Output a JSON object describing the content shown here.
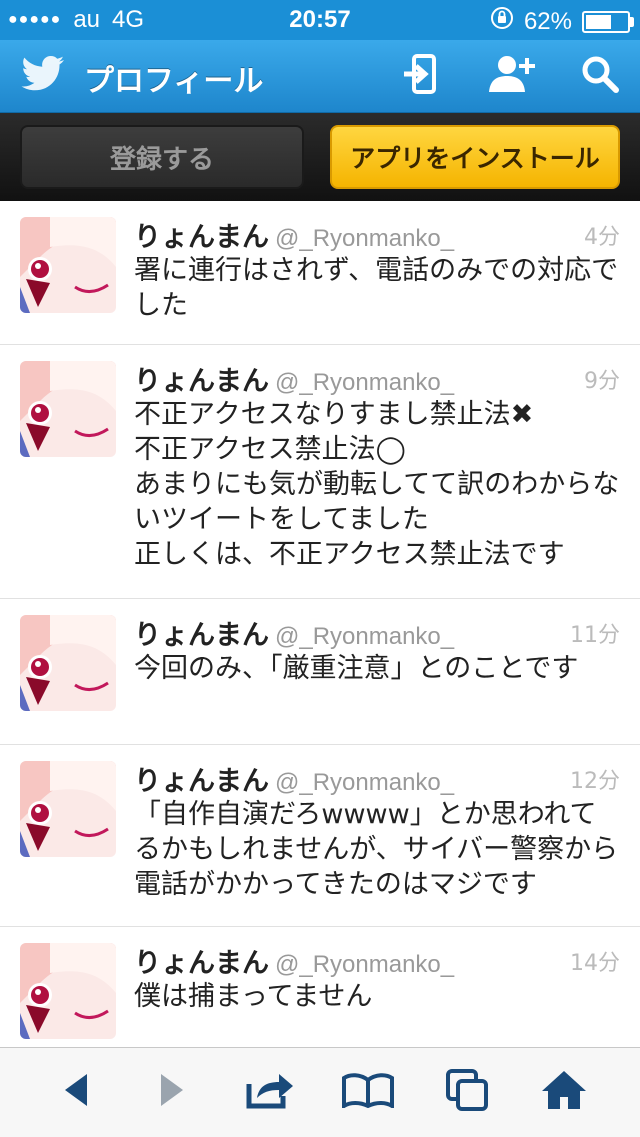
{
  "status_bar": {
    "carrier": "au",
    "network": "4G",
    "time": "20:57",
    "battery_percent": "62%",
    "battery_level": 0.62
  },
  "nav": {
    "title": "プロフィール"
  },
  "actions": {
    "register_label": "登録する",
    "install_label": "アプリをインストール"
  },
  "colors": {
    "status_bar_bg": "#1b8fd6",
    "nav_bg": "#2a98de",
    "install_button": "#fcc31c",
    "action_bar_bg": "#1c1c1c"
  },
  "tweets": [
    {
      "name": "りょんまん",
      "handle": "@_Ryonmanko_",
      "time": "4分",
      "text": "署に連行はされず、電話のみでの対応でした"
    },
    {
      "name": "りょんまん",
      "handle": "@_Ryonmanko_",
      "time": "9分",
      "text": "不正アクセスなりすまし禁止法✖\n不正アクセス禁止法◯\nあまりにも気が動転してて訳のわからないツイートをしてました\n正しくは、不正アクセス禁止法です"
    },
    {
      "name": "りょんまん",
      "handle": "@_Ryonmanko_",
      "time": "11分",
      "text": "今回のみ、「厳重注意」とのことです"
    },
    {
      "name": "りょんまん",
      "handle": "@_Ryonmanko_",
      "time": "12分",
      "text": "「自作自演だろwwww」とか思われてるかもしれませんが、サイバー警察から電話がかかってきたのはマジです"
    },
    {
      "name": "りょんまん",
      "handle": "@_Ryonmanko_",
      "time": "14分",
      "text": "僕は捕まってません"
    }
  ],
  "icons": {
    "nav": [
      "twitter-bird-icon",
      "sign-in-icon",
      "follow-user-icon",
      "search-icon"
    ],
    "toolbar": [
      "back-arrow-icon",
      "forward-arrow-icon",
      "share-icon",
      "bookmarks-icon",
      "tabs-icon",
      "home-icon"
    ]
  }
}
